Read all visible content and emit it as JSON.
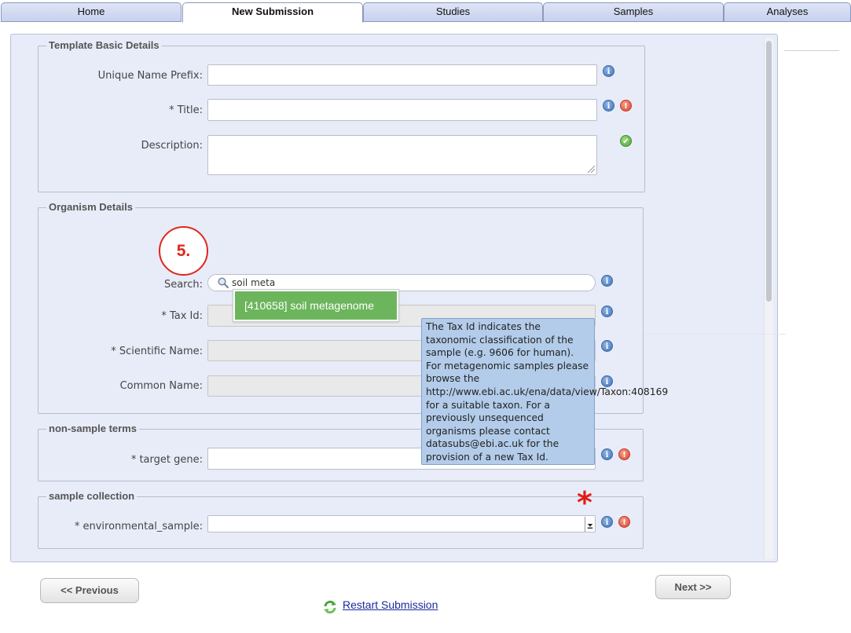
{
  "tabs": [
    {
      "label": "Home"
    },
    {
      "label": "New Submission"
    },
    {
      "label": "Studies"
    },
    {
      "label": "Samples"
    },
    {
      "label": "Analyses"
    }
  ],
  "sections": {
    "template": {
      "legend": "Template Basic Details",
      "unique_name_prefix": {
        "label": "Unique Name Prefix:",
        "value": ""
      },
      "title": {
        "label": "* Title:",
        "value": ""
      },
      "description": {
        "label": "Description:",
        "value": ""
      }
    },
    "organism": {
      "legend": "Organism Details",
      "search": {
        "label": "Search:",
        "value": "soil meta"
      },
      "tax_id": {
        "label": "* Tax Id:",
        "value": ""
      },
      "scientific_name": {
        "label": "* Scientific Name:",
        "value": ""
      },
      "common_name": {
        "label": "Common Name:",
        "value": ""
      },
      "suggestion": "[410658] soil metagenome",
      "tooltip": "The Tax Id indicates the taxonomic classification of the sample (e.g. 9606 for human). For metagenomic samples please browse the http://www.ebi.ac.uk/ena/data/view/Taxon:408169 for a suitable taxon. For a previously unsequenced organisms please contact datasubs@ebi.ac.uk for the provision of a new Tax Id."
    },
    "non_sample": {
      "legend": "non-sample terms",
      "target_gene": {
        "label": "* target gene:",
        "value": ""
      }
    },
    "sample_collection": {
      "legend": "sample collection",
      "environmental_sample": {
        "label": "* environmental_sample:",
        "value": ""
      }
    }
  },
  "annotation": {
    "step_number": "5.",
    "required_marker": "*"
  },
  "icons": {
    "info": "i",
    "error": "!",
    "ok": "✔"
  },
  "buttons": {
    "previous": "<< Previous",
    "next": "Next >>",
    "restart": "Restart Submission"
  },
  "colors": {
    "suggestion_bg": "#6cb55c",
    "tooltip_bg": "#b3ccea",
    "annotation_red": "#e0261c"
  }
}
